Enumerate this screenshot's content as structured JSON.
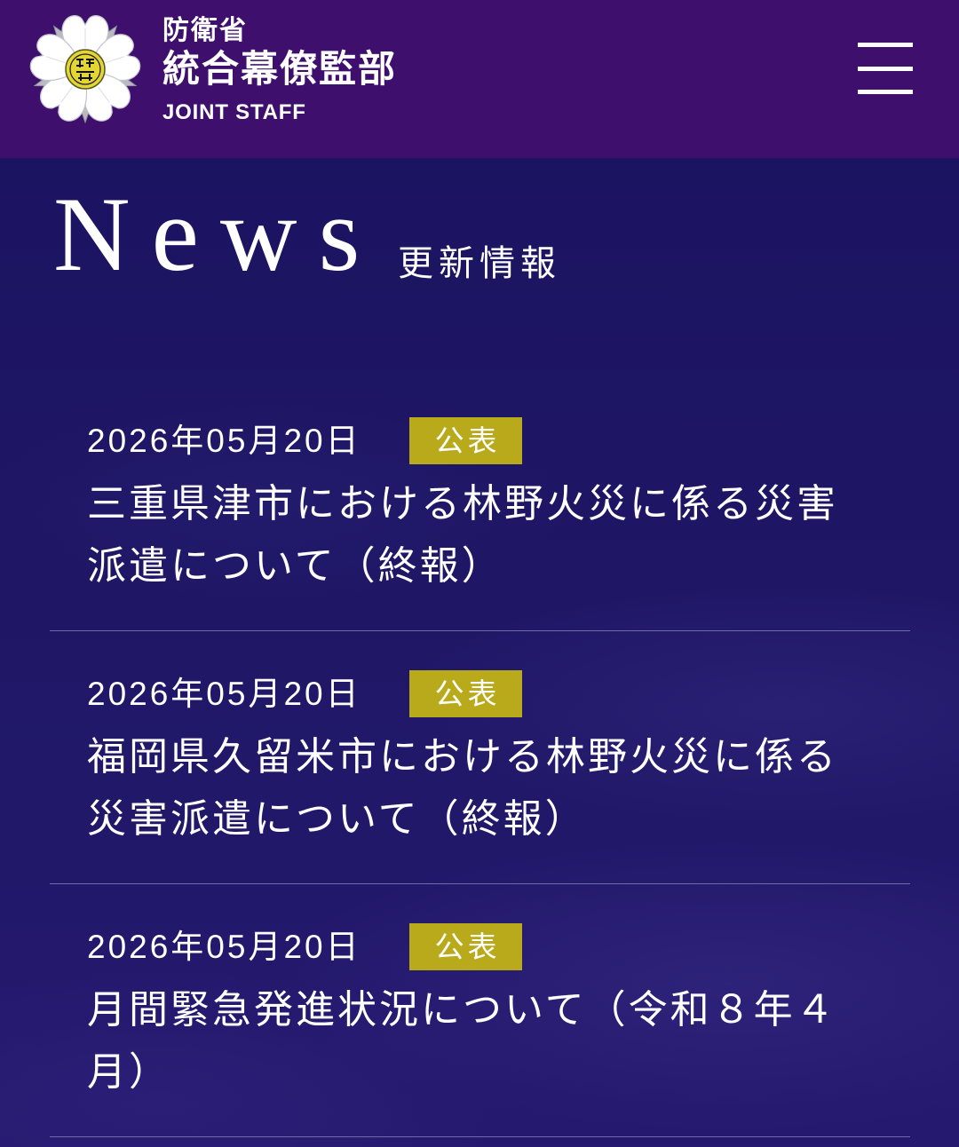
{
  "header": {
    "ministry": "防衛省",
    "organization": "統合幕僚監部",
    "organization_en": "JOINT STAFF",
    "logo_icon": "sakura-emblem-icon",
    "menu_icon": "hamburger-menu-icon"
  },
  "news": {
    "heading": "News",
    "subheading": "更新情報",
    "items": [
      {
        "date": "2026年05月20日",
        "category": "公表",
        "title": "三重県津市における林野火災に係る災害派遣について（終報）"
      },
      {
        "date": "2026年05月20日",
        "category": "公表",
        "title": "福岡県久留米市における林野火災に係る災害派遣について（終報）"
      },
      {
        "date": "2026年05月20日",
        "category": "公表",
        "title": "月間緊急発進状況について（令和８年４月）"
      }
    ]
  },
  "colors": {
    "header_bg": "#3e0f6d",
    "main_bg": "#1f1766",
    "badge_bg": "#b8aa1a",
    "text": "#ffffff",
    "divider": "#6f6ca3"
  }
}
